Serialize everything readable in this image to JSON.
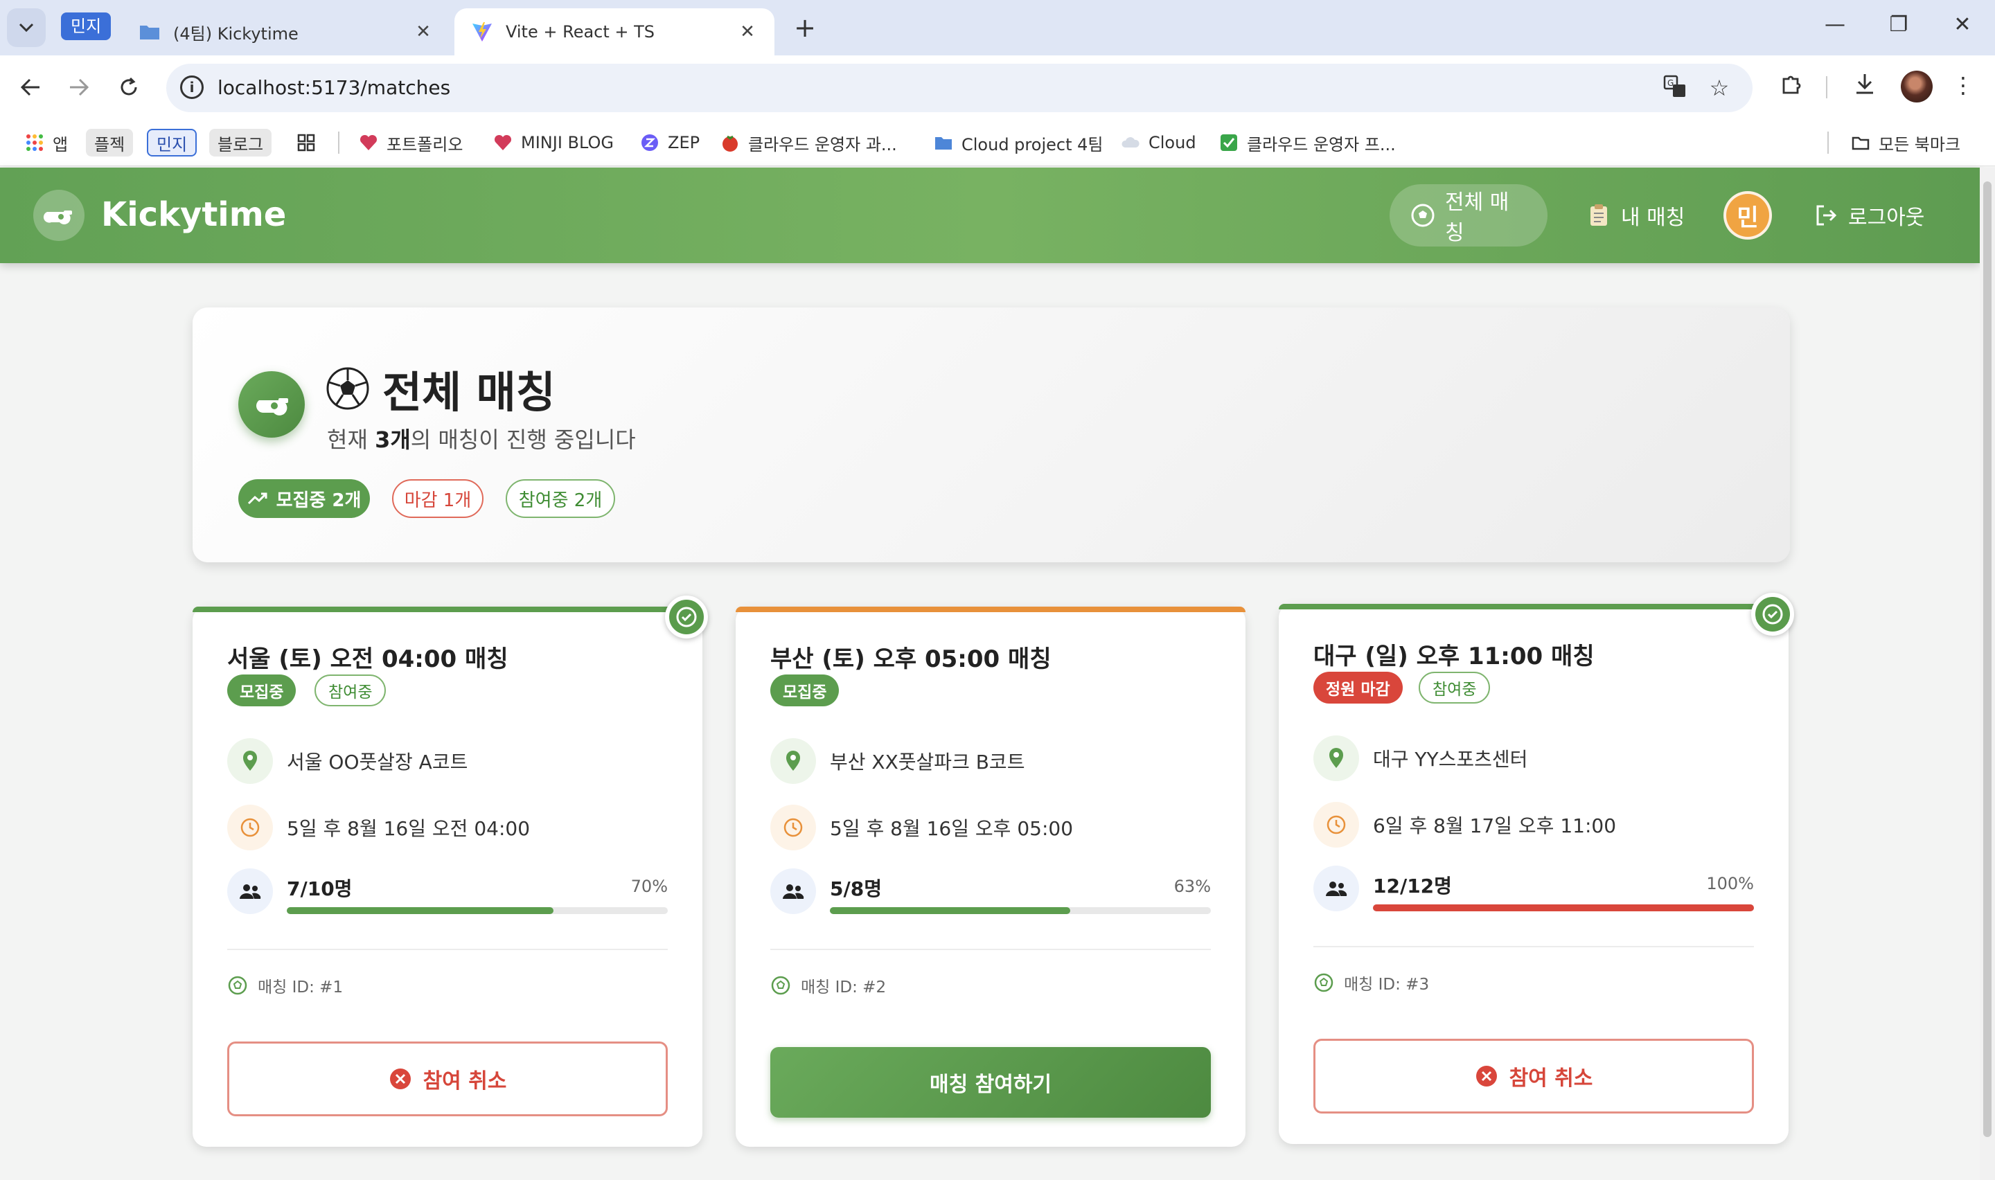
{
  "browser": {
    "tab_group": "민지",
    "tabs": [
      {
        "title": "(4팀) Kickytime",
        "active": false
      },
      {
        "title": "Vite + React + TS",
        "active": true
      }
    ],
    "url": "localhost:5173/matches",
    "bookmarks": [
      {
        "label": "앱",
        "icon": "apps-grid-icon"
      },
      {
        "label": "플젝",
        "style": "chip"
      },
      {
        "label": "민지",
        "style": "chip-outline"
      },
      {
        "label": "블로그",
        "style": "chip"
      },
      {
        "label": "",
        "icon": "tab-groups-icon"
      },
      {
        "label": "포트폴리오",
        "icon": "heart-icon"
      },
      {
        "label": "MINJI BLOG",
        "icon": "heart-icon"
      },
      {
        "label": "ZEP",
        "icon": "zep-icon"
      },
      {
        "label": "클라우드 운영자 과...",
        "icon": "tomato-icon"
      },
      {
        "label": "Cloud project 4팀",
        "icon": "folder-icon"
      },
      {
        "label": "Cloud",
        "icon": "cloud-icon"
      },
      {
        "label": "클라우드 운영자 프...",
        "icon": "checkbox-icon"
      }
    ],
    "all_bookmarks": "모든 북마크"
  },
  "app": {
    "logo": "Kickytime",
    "nav": {
      "all_matches": "전체 매칭",
      "my_matches": "내 매칭",
      "avatar": "민",
      "logout": "로그아웃"
    }
  },
  "hero": {
    "title": "전체 매칭",
    "subtitle_prefix": "현재 ",
    "subtitle_count": "3개",
    "subtitle_suffix": "의 매칭이 진행 중입니다",
    "chips": {
      "recruiting": "모집중 2개",
      "closed": "마감 1개",
      "joined": "참여중 2개"
    }
  },
  "matches": [
    {
      "title": "서울 (토) 오전 04:00 매칭",
      "status": "모집중",
      "joined_badge": "참여중",
      "location": "서울 OO풋살장 A코트",
      "datetime": "5일 후 8월 16일 오전 04:00",
      "capacity": "7/10명",
      "percent_label": "70%",
      "fill": 0.7,
      "match_id": "매칭 ID: #1",
      "action": "참여 취소",
      "accent": "#5c9d4e",
      "bar_color": "#5c9d4e"
    },
    {
      "title": "부산 (토) 오후 05:00 매칭",
      "status": "모집중",
      "joined_badge": "",
      "location": "부산 XX풋살파크 B코트",
      "datetime": "5일 후 8월 16일 오후 05:00",
      "capacity": "5/8명",
      "percent_label": "63%",
      "fill": 0.63,
      "match_id": "매칭 ID: #2",
      "action": "매칭 참여하기",
      "accent": "#e8913a",
      "bar_color": "#5c9d4e"
    },
    {
      "title": "대구 (일) 오후 11:00 매칭",
      "status": "정원 마감",
      "joined_badge": "참여중",
      "location": "대구 YY스포츠센터",
      "datetime": "6일 후 8월 17일 오후 11:00",
      "capacity": "12/12명",
      "percent_label": "100%",
      "fill": 1.0,
      "match_id": "매칭 ID: #3",
      "action": "참여 취소",
      "accent": "#5c9d4e",
      "bar_color": "#d9463b"
    }
  ]
}
